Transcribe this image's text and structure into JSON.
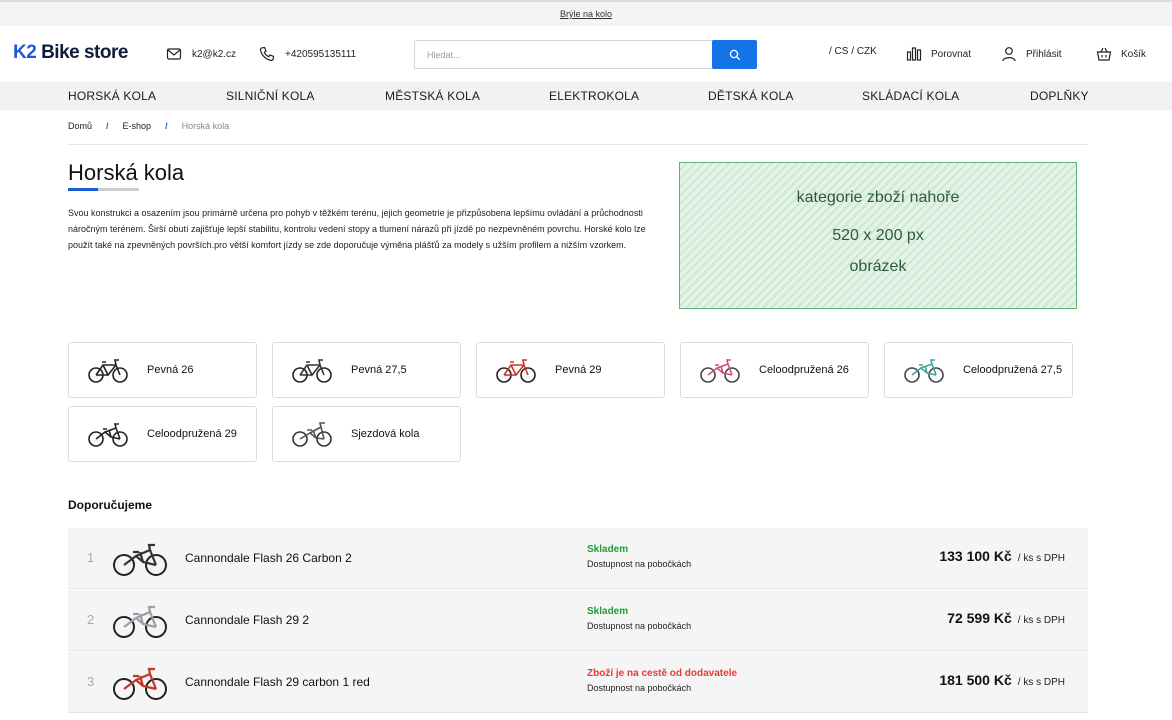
{
  "topbar": {
    "link": "Brýle na kolo"
  },
  "header": {
    "logo_brand": "K2",
    "logo_rest": " Bike store",
    "email": "k2@k2.cz",
    "phone": "+420595135111",
    "search_placeholder": "Hledat...",
    "lang": "/ CS / CZK",
    "compare": "Porovnat",
    "login": "Přihlásit",
    "cart": "Košík"
  },
  "nav": [
    "HORSKÁ KOLA",
    "SILNIČNÍ KOLA",
    "MĚSTSKÁ KOLA",
    "ELEKTROKOLA",
    "DĚTSKÁ KOLA",
    "SKLÁDACÍ KOLA",
    "DOPLŇKY"
  ],
  "breadcrumb": {
    "home": "Domů",
    "sep": "/",
    "eshop": "E-shop",
    "current": "Horská kola"
  },
  "page": {
    "title": "Horská kola",
    "description": "Svou konstrukci a osazením jsou primárně určena pro pohyb v těžkém terénu, jejich geometrie je přizpůsobena lepšímu ovládání a průchodnosti náročným terénem. Širší obutí zajišťuje lepší stabilitu, kontrolu vedení stopy a tlumení nárazů při jízdě po nezpevněném povrchu. Horské kolo lze použít také na zpevněných površích.pro větší komfort jízdy se zde doporučuje výměna plášťů za modely s užším profilem a nižším vzorkem."
  },
  "promo": {
    "line1": "kategorie zboží nahoře",
    "line2": "520 x 200 px",
    "line3": "obrázek"
  },
  "categories": [
    "Pevná 26",
    "Pevná 27,5",
    "Pevná 29",
    "Celoodpružená 26",
    "Celoodpružená 27,5",
    "Celoodpružená 29",
    "Sjezdová kola"
  ],
  "recommended": {
    "title": "Doporučujeme",
    "items": [
      {
        "rank": "1",
        "name": "Cannondale Flash 26 Carbon 2",
        "stock": "Skladem",
        "stock_color": "#1f9c3a",
        "availability": "Dostupnost na pobočkách",
        "price": "133 100 Kč",
        "unit": "/ ks s DPH"
      },
      {
        "rank": "2",
        "name": "Cannondale Flash 29 2",
        "stock": "Skladem",
        "stock_color": "#1f9c3a",
        "availability": "Dostupnost na pobočkách",
        "price": "72 599 Kč",
        "unit": "/ ks s DPH"
      },
      {
        "rank": "3",
        "name": "Cannondale Flash 29 carbon 1 red",
        "stock": "Zboží je na cestě od dodavatele",
        "stock_color": "#e53935",
        "availability": "Dostupnost na pobočkách",
        "price": "181 500 Kč",
        "unit": "/ ks s DPH"
      }
    ]
  }
}
